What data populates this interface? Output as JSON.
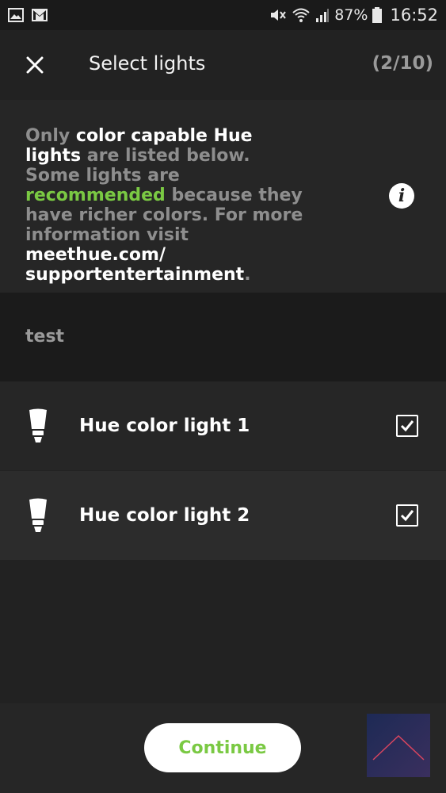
{
  "status_bar": {
    "battery_percent": "87%",
    "time": "16:52",
    "icons": [
      "image-icon",
      "gmail-icon",
      "mute-icon",
      "wifi-icon",
      "signal-icon",
      "battery-icon"
    ]
  },
  "header": {
    "title": "Select lights",
    "counter": "(2/10)",
    "close_icon": "close-icon"
  },
  "info": {
    "parts": [
      {
        "text": "Only ",
        "style": "muted"
      },
      {
        "text": "color capable Hue lights",
        "style": "white"
      },
      {
        "text": " are listed below. Some lights are ",
        "style": "muted"
      },
      {
        "text": "recommended",
        "style": "green"
      },
      {
        "text": " because they have richer colors. For more information visit ",
        "style": "muted"
      },
      {
        "text": "meethue.com/ supportentertainment",
        "style": "white"
      },
      {
        "text": ".",
        "style": "muted"
      }
    ],
    "icon": "info-icon"
  },
  "group": {
    "label": "test"
  },
  "lights": [
    {
      "label": "Hue color light 1",
      "checked": true
    },
    {
      "label": "Hue color light 2",
      "checked": true
    }
  ],
  "footer": {
    "continue_label": "Continue"
  },
  "colors": {
    "accent_green": "#7ac943",
    "background": "#222222"
  }
}
